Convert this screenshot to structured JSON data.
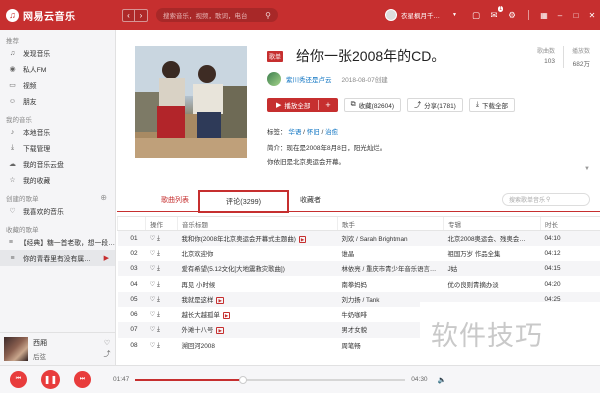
{
  "app": {
    "logo_icon": "music-logo-icon",
    "name": "网易云音乐"
  },
  "header": {
    "back_icon": "‹",
    "forward_icon": "›",
    "search_placeholder": "搜索音乐，视频，歌词，电台",
    "username": "衣星枫月千…",
    "accent": "#c62f2f",
    "message_badge": "1"
  },
  "sidebar": {
    "sections": [
      {
        "title": "推荐",
        "items": [
          {
            "label": "发现音乐",
            "icon": "♫"
          },
          {
            "label": "私人FM",
            "icon": "◉"
          },
          {
            "label": "视频",
            "icon": "▭"
          },
          {
            "label": "朋友",
            "icon": "☺"
          }
        ]
      },
      {
        "title": "我的音乐",
        "items": [
          {
            "label": "本地音乐",
            "icon": "♪"
          },
          {
            "label": "下载管理",
            "icon": "⤓"
          },
          {
            "label": "我的音乐云盘",
            "icon": "☁"
          },
          {
            "label": "我的收藏",
            "icon": "☆"
          }
        ]
      },
      {
        "title": "创建的歌单",
        "items": [
          {
            "label": "我喜欢的音乐",
            "icon": "♡"
          }
        ]
      },
      {
        "title": "收藏的歌单",
        "items": [
          {
            "label": "【经典】糖一首老歌，想一段…",
            "icon": "≡"
          },
          {
            "label": "你的青春里有没有属…",
            "icon": "≡"
          }
        ]
      }
    ]
  },
  "now_playing": {
    "title": "西厢",
    "artist": "后弦"
  },
  "playlist": {
    "tag": "歌单",
    "title": "给你一张2008年的CD。",
    "creator": "紫川秀还是卢云",
    "created": "2018-08-07创建",
    "stats": {
      "songs_label": "歌曲数",
      "songs": "103",
      "plays_label": "播放数",
      "plays": "682万"
    },
    "buttons": {
      "play_all": "播放全部",
      "add": "+",
      "collect": "收藏(82604)",
      "share": "分享(1781)",
      "download": "下载全部"
    },
    "tags_label": "标签：",
    "tags": [
      "华语",
      "怀旧",
      "治愈"
    ],
    "intro_label": "简介：",
    "intro_line1": "现在是2008年8月8日，阳光灿烂。",
    "intro_line2": "你依旧是北京奥运会开幕。"
  },
  "tabs": {
    "songs": "歌曲列表",
    "comments": "评论(3299)",
    "collectors": "收藏者"
  },
  "list_search": {
    "placeholder": "搜索歌单音乐"
  },
  "table": {
    "headers": [
      "",
      "操作",
      "音乐标题",
      "歌手",
      "专辑",
      "时长"
    ],
    "rows": [
      {
        "idx": "01",
        "title": "我和你",
        "sub": "(2008年北京奥运会开幕式主题曲)",
        "mv": true,
        "artist": "刘欢 / Sarah Brightman",
        "album": "北京2008奥运会、残奥会…",
        "time": "04:10"
      },
      {
        "idx": "02",
        "title": "北京欢迎你",
        "sub": "",
        "mv": false,
        "artist": "谁晶",
        "album": "祖国万岁 作品全集",
        "time": "04:12"
      },
      {
        "idx": "03",
        "title": "爱有希望",
        "sub": "(5.12文化[大地震救灾歌曲])",
        "mv": false,
        "artist": "林依亮 / 重庆市青少年音乐语言…",
        "album": "J姑",
        "time": "04:15"
      },
      {
        "idx": "04",
        "title": "再见 小时候",
        "sub": "",
        "mv": false,
        "artist": "南拳妈妈",
        "album": "优の良则青摘办淡",
        "time": "04:20"
      },
      {
        "idx": "05",
        "title": "我就是这样",
        "sub": "",
        "mv": true,
        "artist": "刘力扬 / Tank",
        "album": "",
        "time": "04:25"
      },
      {
        "idx": "06",
        "title": "越长大越孤单",
        "sub": "",
        "mv": true,
        "artist": "牛奶咖啡",
        "album": "",
        "time": ""
      },
      {
        "idx": "07",
        "title": "外滩十八号",
        "sub": "",
        "mv": true,
        "artist": "男才女貌",
        "album": "",
        "time": ""
      },
      {
        "idx": "08",
        "title": "溯回河2008",
        "sub": "",
        "mv": false,
        "artist": "周笔畅",
        "album": "",
        "time": ""
      }
    ]
  },
  "player": {
    "elapsed": "01:47",
    "total": "04:30",
    "progress": 0.4
  },
  "watermark": "软件技巧"
}
